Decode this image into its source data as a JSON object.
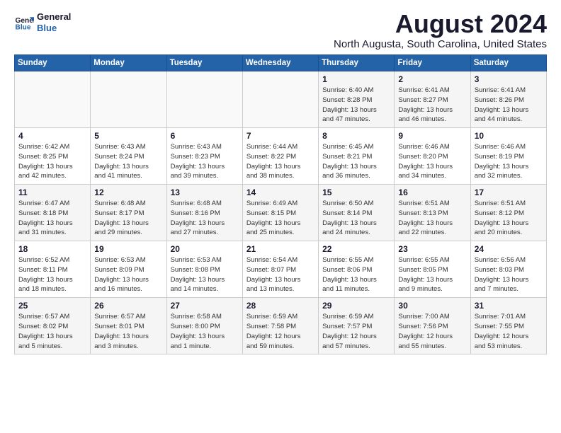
{
  "logo": {
    "line1": "General",
    "line2": "Blue"
  },
  "header": {
    "month": "August 2024",
    "location": "North Augusta, South Carolina, United States"
  },
  "weekdays": [
    "Sunday",
    "Monday",
    "Tuesday",
    "Wednesday",
    "Thursday",
    "Friday",
    "Saturday"
  ],
  "weeks": [
    [
      {
        "day": "",
        "info": ""
      },
      {
        "day": "",
        "info": ""
      },
      {
        "day": "",
        "info": ""
      },
      {
        "day": "",
        "info": ""
      },
      {
        "day": "1",
        "info": "Sunrise: 6:40 AM\nSunset: 8:28 PM\nDaylight: 13 hours\nand 47 minutes."
      },
      {
        "day": "2",
        "info": "Sunrise: 6:41 AM\nSunset: 8:27 PM\nDaylight: 13 hours\nand 46 minutes."
      },
      {
        "day": "3",
        "info": "Sunrise: 6:41 AM\nSunset: 8:26 PM\nDaylight: 13 hours\nand 44 minutes."
      }
    ],
    [
      {
        "day": "4",
        "info": "Sunrise: 6:42 AM\nSunset: 8:25 PM\nDaylight: 13 hours\nand 42 minutes."
      },
      {
        "day": "5",
        "info": "Sunrise: 6:43 AM\nSunset: 8:24 PM\nDaylight: 13 hours\nand 41 minutes."
      },
      {
        "day": "6",
        "info": "Sunrise: 6:43 AM\nSunset: 8:23 PM\nDaylight: 13 hours\nand 39 minutes."
      },
      {
        "day": "7",
        "info": "Sunrise: 6:44 AM\nSunset: 8:22 PM\nDaylight: 13 hours\nand 38 minutes."
      },
      {
        "day": "8",
        "info": "Sunrise: 6:45 AM\nSunset: 8:21 PM\nDaylight: 13 hours\nand 36 minutes."
      },
      {
        "day": "9",
        "info": "Sunrise: 6:46 AM\nSunset: 8:20 PM\nDaylight: 13 hours\nand 34 minutes."
      },
      {
        "day": "10",
        "info": "Sunrise: 6:46 AM\nSunset: 8:19 PM\nDaylight: 13 hours\nand 32 minutes."
      }
    ],
    [
      {
        "day": "11",
        "info": "Sunrise: 6:47 AM\nSunset: 8:18 PM\nDaylight: 13 hours\nand 31 minutes."
      },
      {
        "day": "12",
        "info": "Sunrise: 6:48 AM\nSunset: 8:17 PM\nDaylight: 13 hours\nand 29 minutes."
      },
      {
        "day": "13",
        "info": "Sunrise: 6:48 AM\nSunset: 8:16 PM\nDaylight: 13 hours\nand 27 minutes."
      },
      {
        "day": "14",
        "info": "Sunrise: 6:49 AM\nSunset: 8:15 PM\nDaylight: 13 hours\nand 25 minutes."
      },
      {
        "day": "15",
        "info": "Sunrise: 6:50 AM\nSunset: 8:14 PM\nDaylight: 13 hours\nand 24 minutes."
      },
      {
        "day": "16",
        "info": "Sunrise: 6:51 AM\nSunset: 8:13 PM\nDaylight: 13 hours\nand 22 minutes."
      },
      {
        "day": "17",
        "info": "Sunrise: 6:51 AM\nSunset: 8:12 PM\nDaylight: 13 hours\nand 20 minutes."
      }
    ],
    [
      {
        "day": "18",
        "info": "Sunrise: 6:52 AM\nSunset: 8:11 PM\nDaylight: 13 hours\nand 18 minutes."
      },
      {
        "day": "19",
        "info": "Sunrise: 6:53 AM\nSunset: 8:09 PM\nDaylight: 13 hours\nand 16 minutes."
      },
      {
        "day": "20",
        "info": "Sunrise: 6:53 AM\nSunset: 8:08 PM\nDaylight: 13 hours\nand 14 minutes."
      },
      {
        "day": "21",
        "info": "Sunrise: 6:54 AM\nSunset: 8:07 PM\nDaylight: 13 hours\nand 13 minutes."
      },
      {
        "day": "22",
        "info": "Sunrise: 6:55 AM\nSunset: 8:06 PM\nDaylight: 13 hours\nand 11 minutes."
      },
      {
        "day": "23",
        "info": "Sunrise: 6:55 AM\nSunset: 8:05 PM\nDaylight: 13 hours\nand 9 minutes."
      },
      {
        "day": "24",
        "info": "Sunrise: 6:56 AM\nSunset: 8:03 PM\nDaylight: 13 hours\nand 7 minutes."
      }
    ],
    [
      {
        "day": "25",
        "info": "Sunrise: 6:57 AM\nSunset: 8:02 PM\nDaylight: 13 hours\nand 5 minutes."
      },
      {
        "day": "26",
        "info": "Sunrise: 6:57 AM\nSunset: 8:01 PM\nDaylight: 13 hours\nand 3 minutes."
      },
      {
        "day": "27",
        "info": "Sunrise: 6:58 AM\nSunset: 8:00 PM\nDaylight: 13 hours\nand 1 minute."
      },
      {
        "day": "28",
        "info": "Sunrise: 6:59 AM\nSunset: 7:58 PM\nDaylight: 12 hours\nand 59 minutes."
      },
      {
        "day": "29",
        "info": "Sunrise: 6:59 AM\nSunset: 7:57 PM\nDaylight: 12 hours\nand 57 minutes."
      },
      {
        "day": "30",
        "info": "Sunrise: 7:00 AM\nSunset: 7:56 PM\nDaylight: 12 hours\nand 55 minutes."
      },
      {
        "day": "31",
        "info": "Sunrise: 7:01 AM\nSunset: 7:55 PM\nDaylight: 12 hours\nand 53 minutes."
      }
    ]
  ]
}
